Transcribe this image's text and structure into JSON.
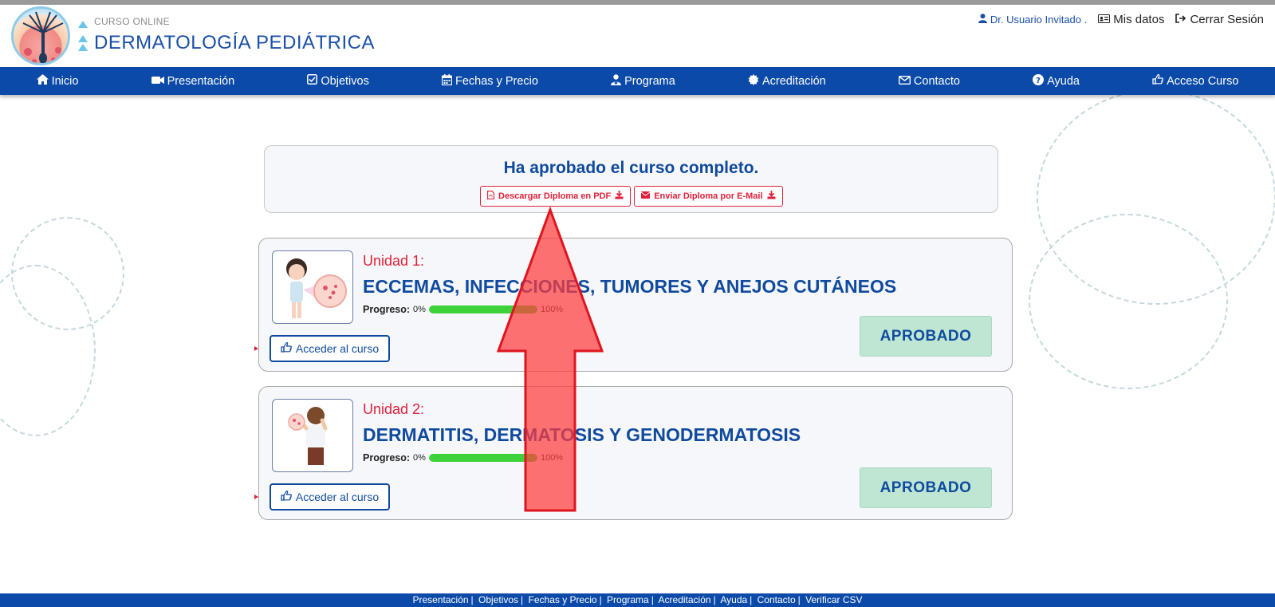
{
  "header": {
    "brand_small": "CURSO ONLINE",
    "brand_big": "DERMATOLOGÍA  PEDIÁTRICA",
    "user": "Dr. Usuario Invitado .",
    "my_data": "Mis datos",
    "logout": "Cerrar Sesión"
  },
  "nav": {
    "items": [
      {
        "label": "Inicio",
        "icon": "home-icon"
      },
      {
        "label": "Presentación",
        "icon": "video-camera-icon"
      },
      {
        "label": "Objetivos",
        "icon": "check-square-icon"
      },
      {
        "label": "Fechas y Precio",
        "icon": "calendar-icon"
      },
      {
        "label": "Programa",
        "icon": "user-doctor-icon"
      },
      {
        "label": "Acreditación",
        "icon": "certificate-icon"
      },
      {
        "label": "Contacto",
        "icon": "envelope-icon"
      },
      {
        "label": "Ayuda",
        "icon": "question-circle-icon"
      },
      {
        "label": "Acceso Curso",
        "icon": "hand-pointer-icon"
      }
    ]
  },
  "approval": {
    "title": "Ha aprobado el curso completo.",
    "download_pdf": "Descargar Diploma en PDF",
    "send_email": "Enviar Diploma por E-Mail"
  },
  "units": [
    {
      "label": "Unidad 1:",
      "title": "ECCEMAS, INFECCIONES, TUMORES Y ANEJOS CUTÁNEOS",
      "progress_label": "Progreso:",
      "progress_min": "0%",
      "progress_max": "100%",
      "progress_value": 1.0,
      "access": "Acceder al curso",
      "status": "APROBADO"
    },
    {
      "label": "Unidad 2:",
      "title": "DERMATITIS, DERMATOSIS Y GENODERMATOSIS",
      "progress_label": "Progreso:",
      "progress_min": "0%",
      "progress_max": "100%",
      "progress_value": 1.0,
      "access": "Acceder al curso",
      "status": "APROBADO"
    }
  ],
  "footer": {
    "links": [
      "Presentación",
      "Objetivos",
      "Fechas y Precio",
      "Programa",
      "Acreditación",
      "Ayuda",
      "Contacto",
      "Verificar CSV"
    ]
  },
  "colors": {
    "primary": "#0b4aa8",
    "accent_red": "#e0203a",
    "approved_bg": "#bfe5d3",
    "progress_green": "#3ed23a"
  }
}
